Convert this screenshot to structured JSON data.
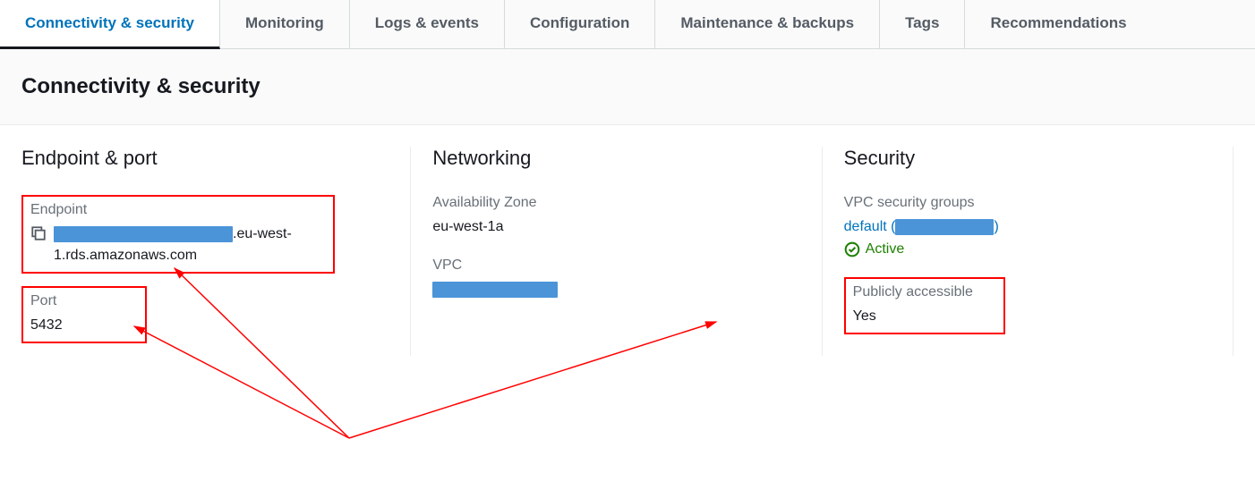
{
  "tabs": [
    {
      "label": "Connectivity & security",
      "active": true
    },
    {
      "label": "Monitoring",
      "active": false
    },
    {
      "label": "Logs & events",
      "active": false
    },
    {
      "label": "Configuration",
      "active": false
    },
    {
      "label": "Maintenance & backups",
      "active": false
    },
    {
      "label": "Tags",
      "active": false
    },
    {
      "label": "Recommendations",
      "active": false
    }
  ],
  "pageTitle": "Connectivity & security",
  "endpointPort": {
    "heading": "Endpoint & port",
    "endpointLabel": "Endpoint",
    "endpointSuffix": ".eu-west-1.rds.amazonaws.com",
    "portLabel": "Port",
    "portValue": "5432"
  },
  "networking": {
    "heading": "Networking",
    "azLabel": "Availability Zone",
    "azValue": "eu-west-1a",
    "vpcLabel": "VPC"
  },
  "security": {
    "heading": "Security",
    "sgLabel": "VPC security groups",
    "sgLinkPrefix": "default (",
    "sgLinkSuffix": ")",
    "statusText": "Active",
    "publicLabel": "Publicly accessible",
    "publicValue": "Yes"
  }
}
